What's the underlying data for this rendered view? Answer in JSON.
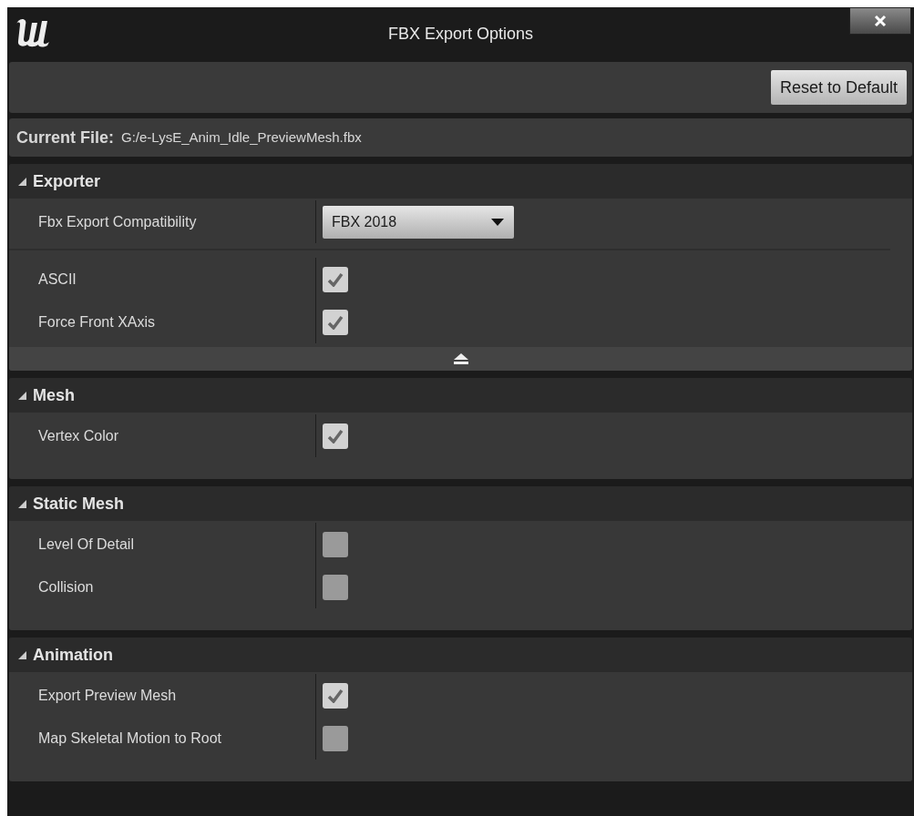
{
  "window": {
    "title": "FBX Export Options"
  },
  "toolbar": {
    "reset_button": "Reset to Default"
  },
  "current_file": {
    "label": "Current File:",
    "value": "G:/e-LysE_Anim_Idle_PreviewMesh.fbx"
  },
  "sections": [
    {
      "title": "Exporter",
      "expanded": true,
      "advanced_expanded": true,
      "groups": [
        [
          {
            "kind": "dropdown",
            "label": "Fbx Export Compatibility",
            "value": "FBX 2018"
          }
        ],
        [
          {
            "kind": "checkbox",
            "label": "ASCII",
            "checked": true
          },
          {
            "kind": "checkbox",
            "label": "Force Front XAxis",
            "checked": true
          }
        ]
      ]
    },
    {
      "title": "Mesh",
      "expanded": true,
      "groups": [
        [
          {
            "kind": "checkbox",
            "label": "Vertex Color",
            "checked": true
          }
        ]
      ]
    },
    {
      "title": "Static Mesh",
      "expanded": true,
      "groups": [
        [
          {
            "kind": "checkbox",
            "label": "Level Of Detail",
            "checked": false
          },
          {
            "kind": "checkbox",
            "label": "Collision",
            "checked": false
          }
        ]
      ]
    },
    {
      "title": "Animation",
      "expanded": true,
      "groups": [
        [
          {
            "kind": "checkbox",
            "label": "Export Preview Mesh",
            "checked": true
          },
          {
            "kind": "checkbox",
            "label": "Map Skeletal Motion to Root",
            "checked": false
          }
        ]
      ]
    }
  ]
}
